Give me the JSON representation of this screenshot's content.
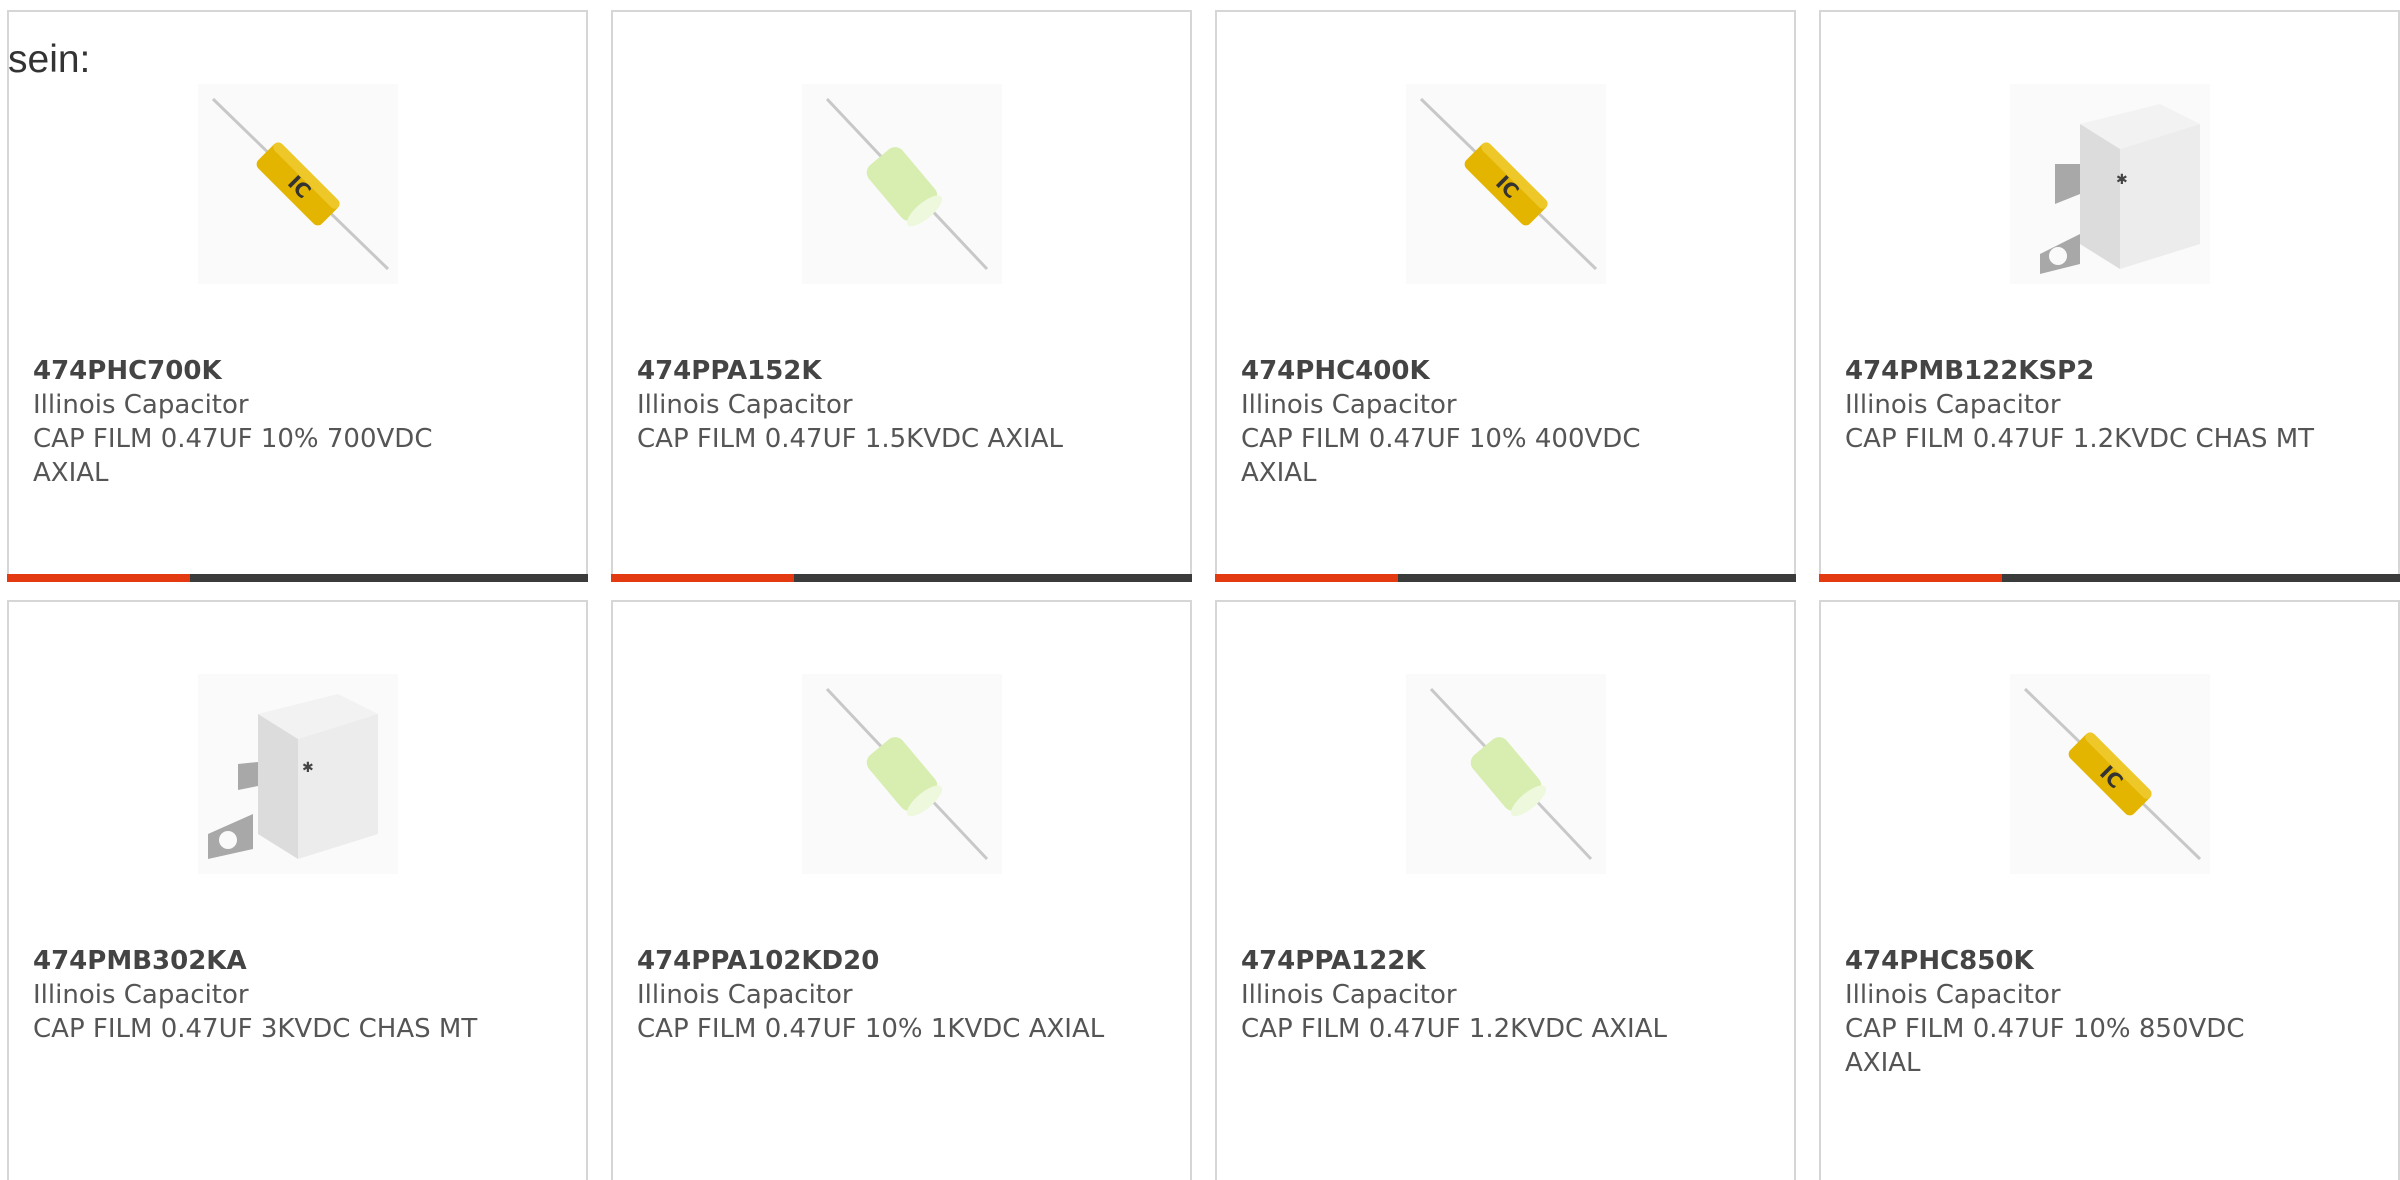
{
  "lead_text": "sein:",
  "products": [
    {
      "part_number": "474PHC700K",
      "manufacturer": "Illinois Capacitor",
      "description": "CAP FILM 0.47UF 10% 700VDC AXIAL",
      "image": "yellow-axial-capacitor"
    },
    {
      "part_number": "474PPA152K",
      "manufacturer": "Illinois Capacitor",
      "description": "CAP FILM 0.47UF 1.5KVDC AXIAL",
      "image": "green-axial-capacitor"
    },
    {
      "part_number": "474PHC400K",
      "manufacturer": "Illinois Capacitor",
      "description": "CAP FILM 0.47UF 10% 400VDC AXIAL",
      "image": "yellow-axial-capacitor"
    },
    {
      "part_number": "474PMB122KSP2",
      "manufacturer": "Illinois Capacitor",
      "description": "CAP FILM 0.47UF 1.2KVDC CHAS MT",
      "image": "white-chassis-capacitor"
    },
    {
      "part_number": "474PMB302KA",
      "manufacturer": "Illinois Capacitor",
      "description": "CAP FILM 0.47UF 3KVDC CHAS MT",
      "image": "white-chassis-capacitor"
    },
    {
      "part_number": "474PPA102KD20",
      "manufacturer": "Illinois Capacitor",
      "description": "CAP FILM 0.47UF 10% 1KVDC AXIAL",
      "image": "green-axial-capacitor"
    },
    {
      "part_number": "474PPA122K",
      "manufacturer": "Illinois Capacitor",
      "description": "CAP FILM 0.47UF 1.2KVDC AXIAL",
      "image": "green-axial-capacitor"
    },
    {
      "part_number": "474PHC850K",
      "manufacturer": "Illinois Capacitor",
      "description": "CAP FILM 0.47UF 10% 850VDC AXIAL",
      "image": "yellow-axial-capacitor"
    }
  ],
  "colors": {
    "accent": "#e33a12",
    "bar": "#3b3b3b",
    "yellow_body": "#e3b400",
    "green_body": "#d7eeb0"
  }
}
